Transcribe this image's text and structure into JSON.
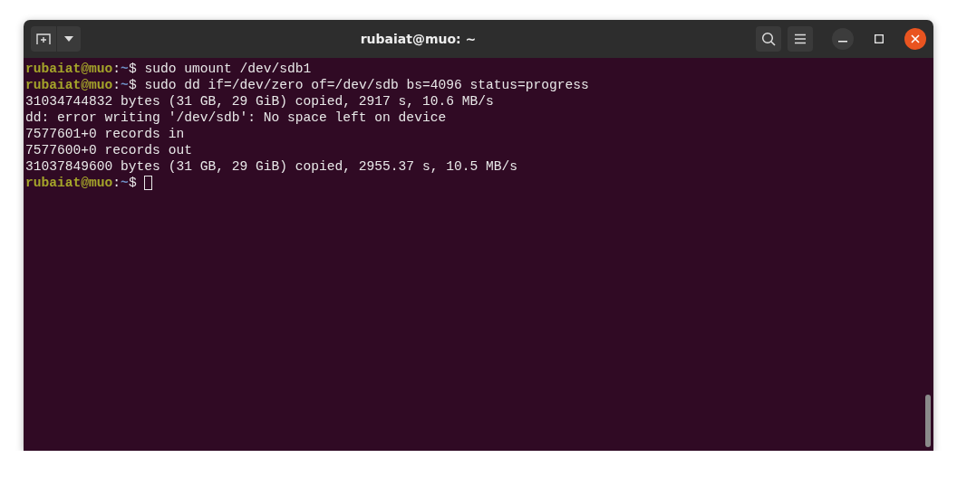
{
  "window": {
    "title": "rubaiat@muo: ~"
  },
  "terminal": {
    "lines": [
      {
        "kind": "prompt",
        "user": "rubaiat@muo",
        "sep": ":",
        "path": "~",
        "symbol": "$",
        "command": "sudo umount /dev/sdb1"
      },
      {
        "kind": "prompt",
        "user": "rubaiat@muo",
        "sep": ":",
        "path": "~",
        "symbol": "$",
        "command": "sudo dd if=/dev/zero of=/dev/sdb bs=4096 status=progress"
      },
      {
        "kind": "output",
        "text": "31034744832 bytes (31 GB, 29 GiB) copied, 2917 s, 10.6 MB/s"
      },
      {
        "kind": "output",
        "text": "dd: error writing '/dev/sdb': No space left on device"
      },
      {
        "kind": "output",
        "text": "7577601+0 records in"
      },
      {
        "kind": "output",
        "text": "7577600+0 records out"
      },
      {
        "kind": "output",
        "text": "31037849600 bytes (31 GB, 29 GiB) copied, 2955.37 s, 10.5 MB/s"
      },
      {
        "kind": "prompt",
        "user": "rubaiat@muo",
        "sep": ":",
        "path": "~",
        "symbol": "$",
        "cursor": true
      }
    ]
  }
}
